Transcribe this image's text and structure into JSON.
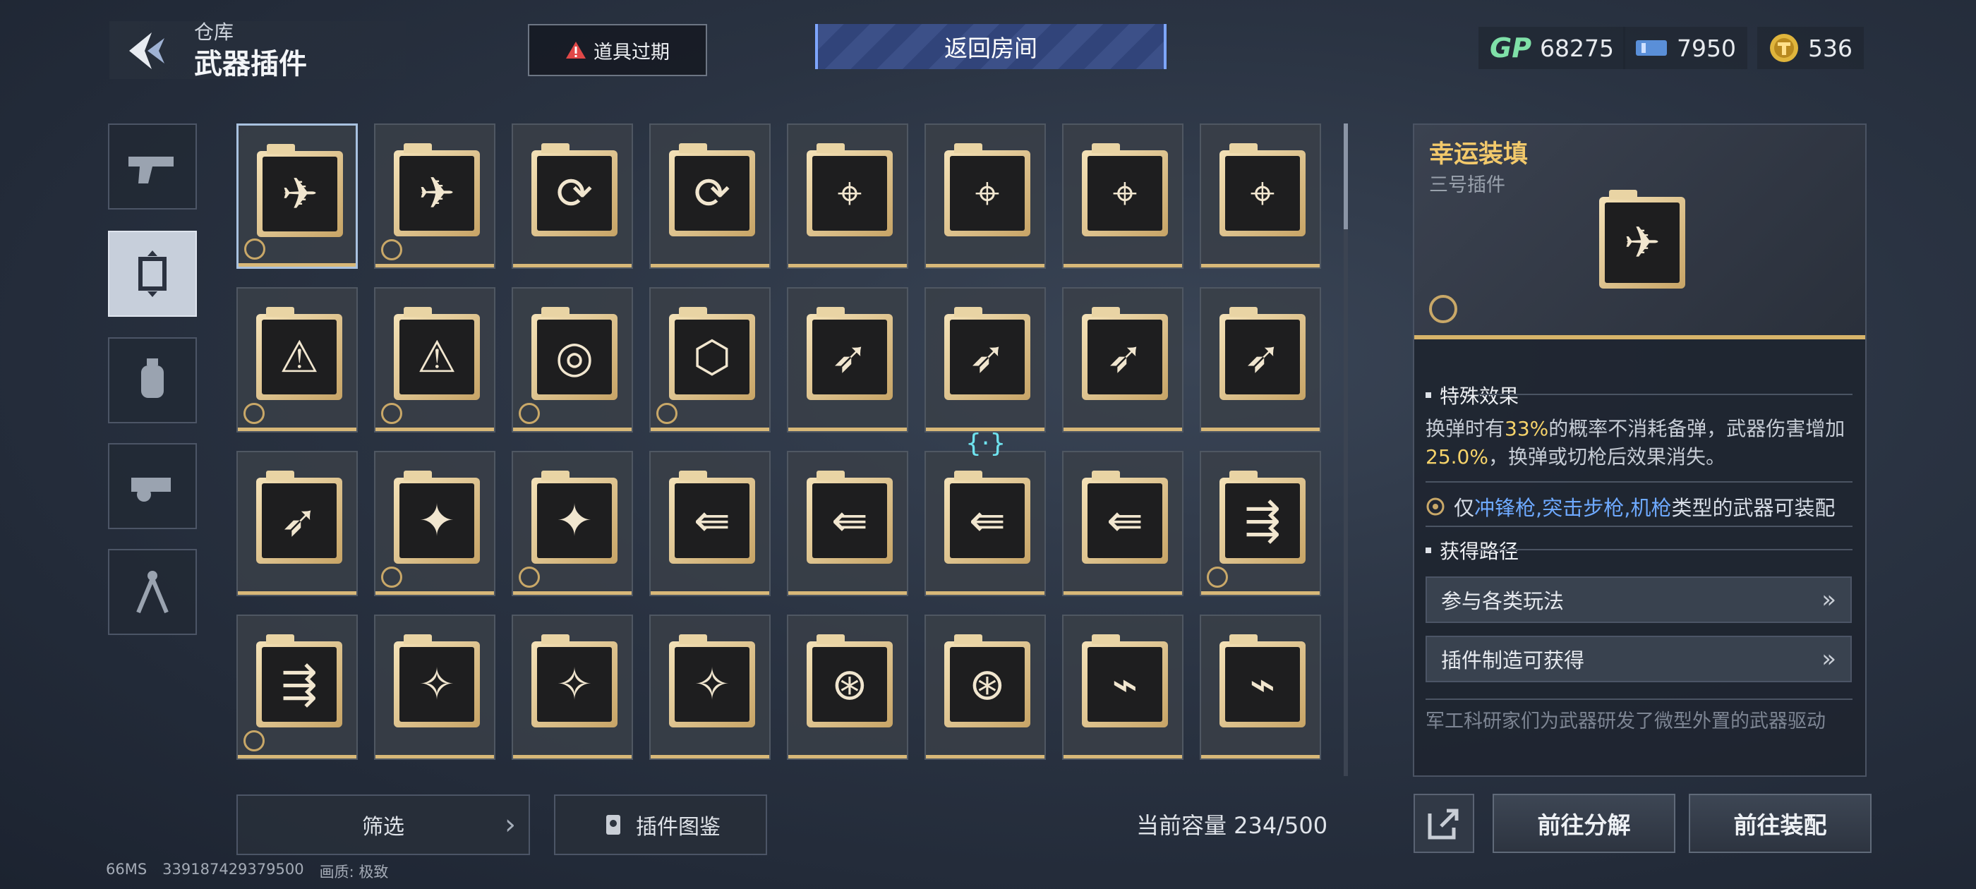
{
  "header": {
    "breadcrumb_parent": "仓库",
    "title": "武器插件",
    "expire_label": "道具过期",
    "return_label": "返回房间",
    "currencies": [
      {
        "icon": "gp-icon",
        "value": "68275"
      },
      {
        "icon": "ticket-icon",
        "value": "7950"
      },
      {
        "icon": "coin-icon",
        "value": "536"
      }
    ]
  },
  "categories": [
    {
      "name": "pistol"
    },
    {
      "name": "plugin",
      "active": true
    },
    {
      "name": "grenade"
    },
    {
      "name": "attachment"
    },
    {
      "name": "tool"
    }
  ],
  "grid": {
    "items": [
      {
        "glyph": "✈",
        "badge": true,
        "selected": true
      },
      {
        "glyph": "✈",
        "badge": true
      },
      {
        "glyph": "⟳",
        "badge": false
      },
      {
        "glyph": "⟳",
        "badge": false
      },
      {
        "glyph": "⌖",
        "badge": false
      },
      {
        "glyph": "⌖",
        "badge": false
      },
      {
        "glyph": "⌖",
        "badge": false
      },
      {
        "glyph": "⌖",
        "badge": false
      },
      {
        "glyph": "⚠",
        "badge": true
      },
      {
        "glyph": "⚠",
        "badge": true
      },
      {
        "glyph": "◎",
        "badge": true
      },
      {
        "glyph": "⬡",
        "badge": true
      },
      {
        "glyph": "➶",
        "badge": false
      },
      {
        "glyph": "➶",
        "badge": false
      },
      {
        "glyph": "➶",
        "badge": false
      },
      {
        "glyph": "➶",
        "badge": false
      },
      {
        "glyph": "➶",
        "badge": false
      },
      {
        "glyph": "✦",
        "badge": true
      },
      {
        "glyph": "✦",
        "badge": true
      },
      {
        "glyph": "⇚",
        "badge": false
      },
      {
        "glyph": "⇚",
        "badge": false
      },
      {
        "glyph": "⇚",
        "badge": false
      },
      {
        "glyph": "⇚",
        "badge": false
      },
      {
        "glyph": "⇶",
        "badge": true
      },
      {
        "glyph": "⇶",
        "badge": true
      },
      {
        "glyph": "✧",
        "badge": false
      },
      {
        "glyph": "✧",
        "badge": false
      },
      {
        "glyph": "✧",
        "badge": false
      },
      {
        "glyph": "⊛",
        "badge": false
      },
      {
        "glyph": "⊛",
        "badge": false
      },
      {
        "glyph": "⌁",
        "badge": false
      },
      {
        "glyph": "⌁",
        "badge": false
      }
    ]
  },
  "bottom": {
    "filter_label": "筛选",
    "atlas_label": "插件图鉴",
    "capacity_label": "当前容量 234/500"
  },
  "status_bar": {
    "ping": "66MS",
    "uid": "339187429379500",
    "quality": "画质:  极致"
  },
  "detail": {
    "title": "幸运装填",
    "subtitle": "三号插件",
    "special_effect_heading": "特殊效果",
    "effect_part1": "换弹时有",
    "effect_value1": "33%",
    "effect_part2": "的概率不消耗备弹，武器伤害增加",
    "effect_value2": "25.0%",
    "effect_part3": "，换弹或切枪后效果消失。",
    "req_prefix": "仅",
    "req_weapons": "冲锋枪,突击步枪,机枪",
    "req_suffix": "类型的武器可装配",
    "acquire_heading": "获得路径",
    "route1": "参与各类玩法",
    "route2": "插件制造可获得",
    "lore": "军工科研家们为武器研发了微型外置的武器驱动"
  },
  "actions": {
    "dismantle_label": "前往分解",
    "equip_label": "前往装配"
  },
  "colors": {
    "accent_gold": "#d7b46a",
    "highlight_yellow": "#f6d36a",
    "weapon_blue": "#6ea9ff",
    "return_button": "#3c5088"
  }
}
